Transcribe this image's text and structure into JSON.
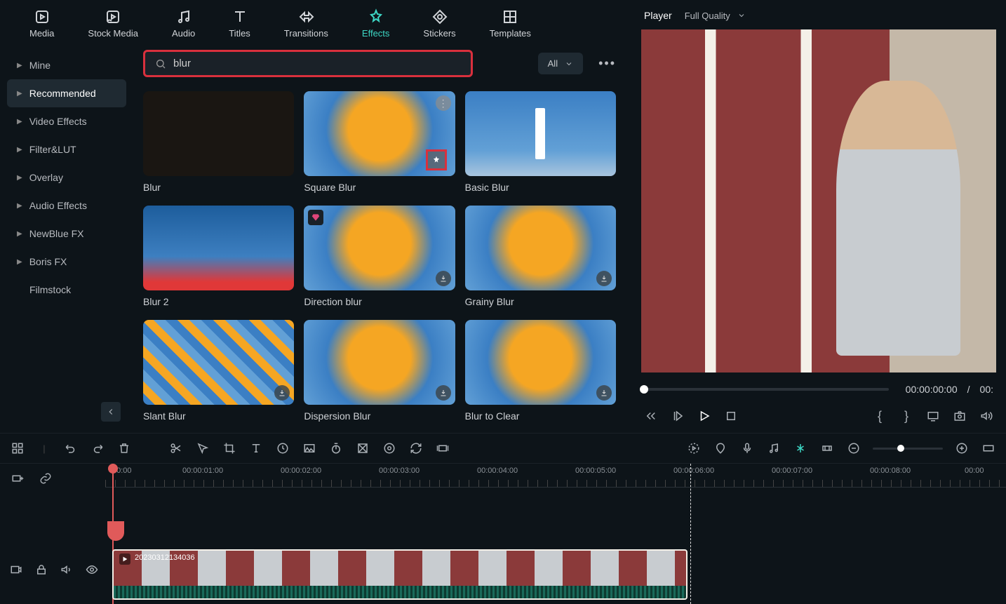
{
  "topnav": [
    {
      "id": "media",
      "label": "Media"
    },
    {
      "id": "stock",
      "label": "Stock Media"
    },
    {
      "id": "audio",
      "label": "Audio"
    },
    {
      "id": "titles",
      "label": "Titles"
    },
    {
      "id": "transitions",
      "label": "Transitions"
    },
    {
      "id": "effects",
      "label": "Effects"
    },
    {
      "id": "stickers",
      "label": "Stickers"
    },
    {
      "id": "templates",
      "label": "Templates"
    }
  ],
  "sidebar": [
    {
      "id": "mine",
      "label": "Mine"
    },
    {
      "id": "recommended",
      "label": "Recommended"
    },
    {
      "id": "video-effects",
      "label": "Video Effects"
    },
    {
      "id": "filter-lut",
      "label": "Filter&LUT"
    },
    {
      "id": "overlay",
      "label": "Overlay"
    },
    {
      "id": "audio-effects",
      "label": "Audio Effects"
    },
    {
      "id": "newblue",
      "label": "NewBlue FX"
    },
    {
      "id": "boris",
      "label": "Boris FX"
    },
    {
      "id": "filmstock",
      "label": "Filmstock"
    }
  ],
  "search": {
    "value": "blur"
  },
  "filter": {
    "label": "All"
  },
  "effects": [
    {
      "id": "blur",
      "label": "Blur",
      "thumb": "dark"
    },
    {
      "id": "square-blur",
      "label": "Square Blur",
      "thumb": "flower",
      "highlighted": true,
      "moreDot": true
    },
    {
      "id": "basic-blur",
      "label": "Basic Blur",
      "thumb": "lighthouse"
    },
    {
      "id": "blur-2",
      "label": "Blur 2",
      "thumb": "woman"
    },
    {
      "id": "direction-blur",
      "label": "Direction blur",
      "thumb": "flower",
      "gem": true,
      "download": true
    },
    {
      "id": "grainy-blur",
      "label": "Grainy Blur",
      "thumb": "flower",
      "download": true
    },
    {
      "id": "slant-blur",
      "label": "Slant Blur",
      "thumb": "pixelate",
      "download": true
    },
    {
      "id": "dispersion-blur",
      "label": "Dispersion Blur",
      "thumb": "flower",
      "download": true
    },
    {
      "id": "blur-to-clear",
      "label": "Blur to Clear",
      "thumb": "flower",
      "download": true
    }
  ],
  "player": {
    "title": "Player",
    "quality": "Full Quality",
    "current": "00:00:00:00",
    "sep": "/",
    "duration": "00:"
  },
  "ruler": [
    "00:00",
    "00:00:01:00",
    "00:00:02:00",
    "00:00:03:00",
    "00:00:04:00",
    "00:00:05:00",
    "00:00:06:00",
    "00:00:07:00",
    "00:00:08:00",
    "00:00"
  ],
  "clip": {
    "name": "20230312134036"
  }
}
